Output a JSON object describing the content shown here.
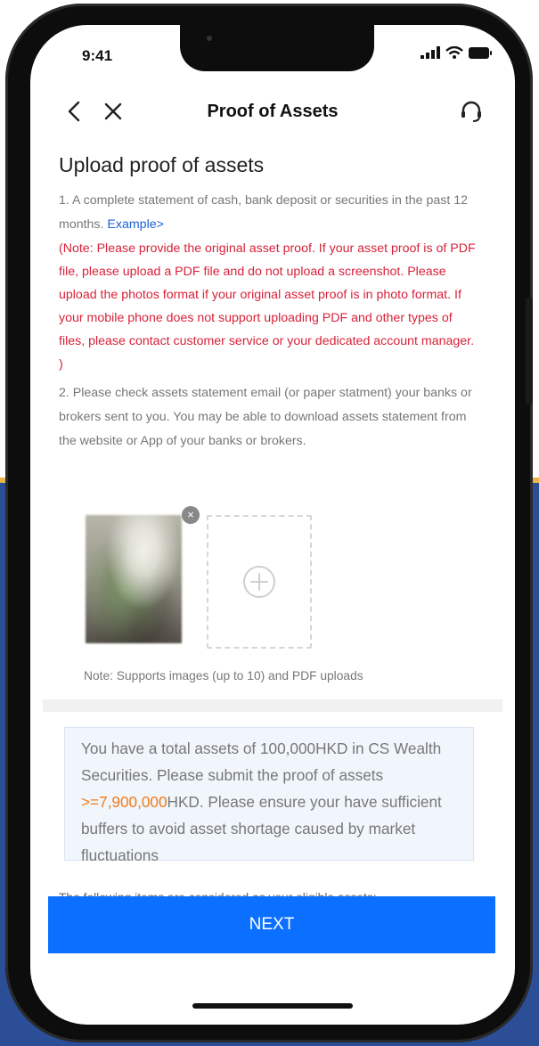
{
  "status_bar": {
    "time": "9:41"
  },
  "nav": {
    "title": "Proof of Assets",
    "back_icon": "chevron-left-icon",
    "close_icon": "close-icon",
    "support_icon": "headset-icon"
  },
  "upload": {
    "heading": "Upload proof of assets",
    "instruction_1": "1. A complete statement of cash, bank deposit or securities in the past 12 months.",
    "example_link": "Example>",
    "warning": "(Note: Please provide the original asset proof. If your asset proof is of PDF file, please upload a PDF file and do not upload a screenshot. Please upload the photos format if your original asset proof is in photo format. If your mobile phone does not support uploading PDF and other types of files, please contact customer service or your dedicated account manager. )",
    "instruction_2": "2. Please check assets statement email (or paper statment) your banks or brokers sent to you. You may be able to download assets statement from the website or App of your banks or brokers.",
    "remove_glyph": "×",
    "upload_note": "Note: Supports images (up to 10) and PDF uploads"
  },
  "notice": {
    "text_before": "You have a total assets of 100,000HKD in CS Wealth Securities. Please submit the proof of assets ",
    "amount": ">=7,900,000",
    "text_after": "HKD. Please ensure your have sufficient buffers to avoid asset shortage caused by market fluctuations"
  },
  "eligible_heading": "The following items are considered as your eligible assets:",
  "next_button": "NEXT",
  "colors": {
    "primary": "#0b6fff",
    "warning": "#d8223a",
    "link": "#1e62d6",
    "amount": "#f07a1a",
    "background_blue": "#2b4e96"
  }
}
